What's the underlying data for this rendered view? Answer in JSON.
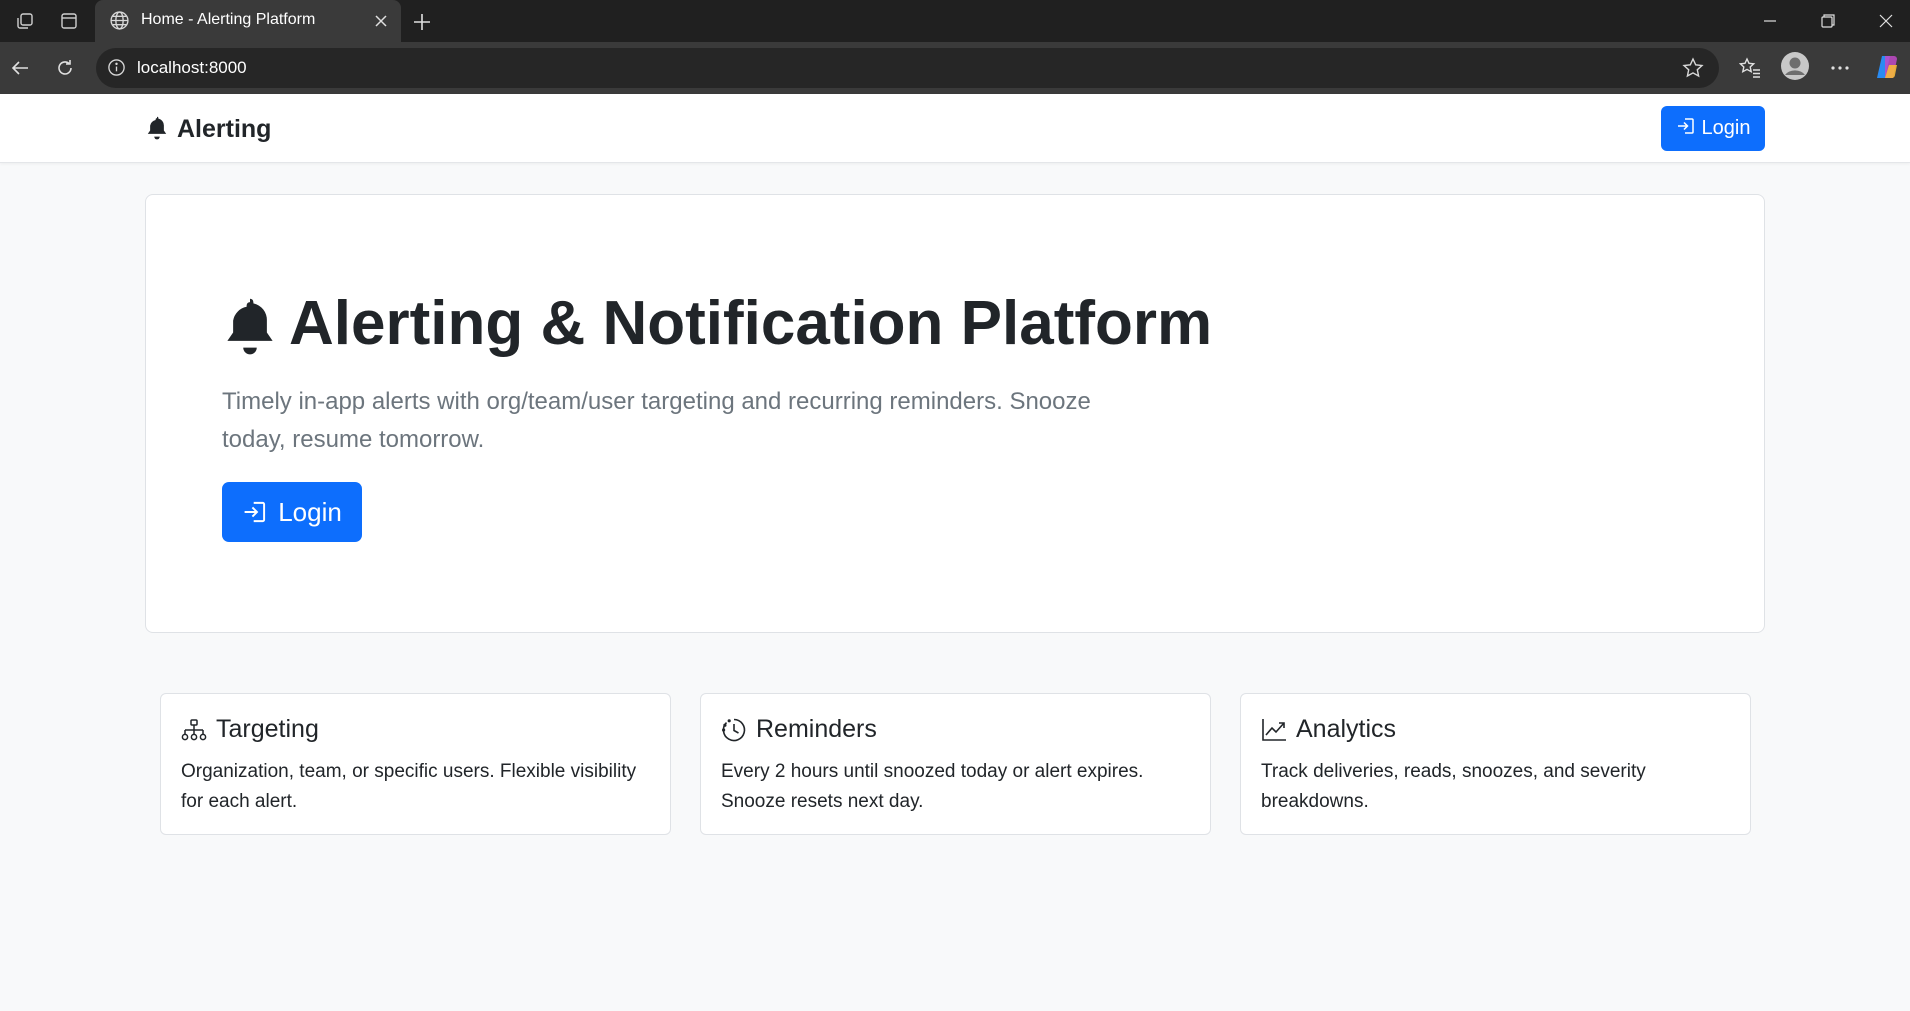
{
  "browser": {
    "tab_title": "Home - Alerting Platform",
    "url": "localhost:8000"
  },
  "navbar": {
    "brand": "Alerting",
    "login_label": "Login"
  },
  "hero": {
    "title": "Alerting & Notification Platform",
    "subtitle": "Timely in-app alerts with org/team/user targeting and recurring reminders. Snooze today, resume tomorrow.",
    "login_label": "Login"
  },
  "features": [
    {
      "title": "Targeting",
      "text": "Organization, team, or specific users. Flexible visibility for each alert.",
      "icon": "diagram-icon"
    },
    {
      "title": "Reminders",
      "text": "Every 2 hours until snoozed today or alert expires. Snooze resets next day.",
      "icon": "clock-icon"
    },
    {
      "title": "Analytics",
      "text": "Track deliveries, reads, snoozes, and severity breakdowns.",
      "icon": "graph-up-icon"
    }
  ],
  "colors": {
    "primary": "#0d6efd",
    "text": "#212529",
    "muted": "#6c757d",
    "page_bg": "#f8f9fa"
  }
}
